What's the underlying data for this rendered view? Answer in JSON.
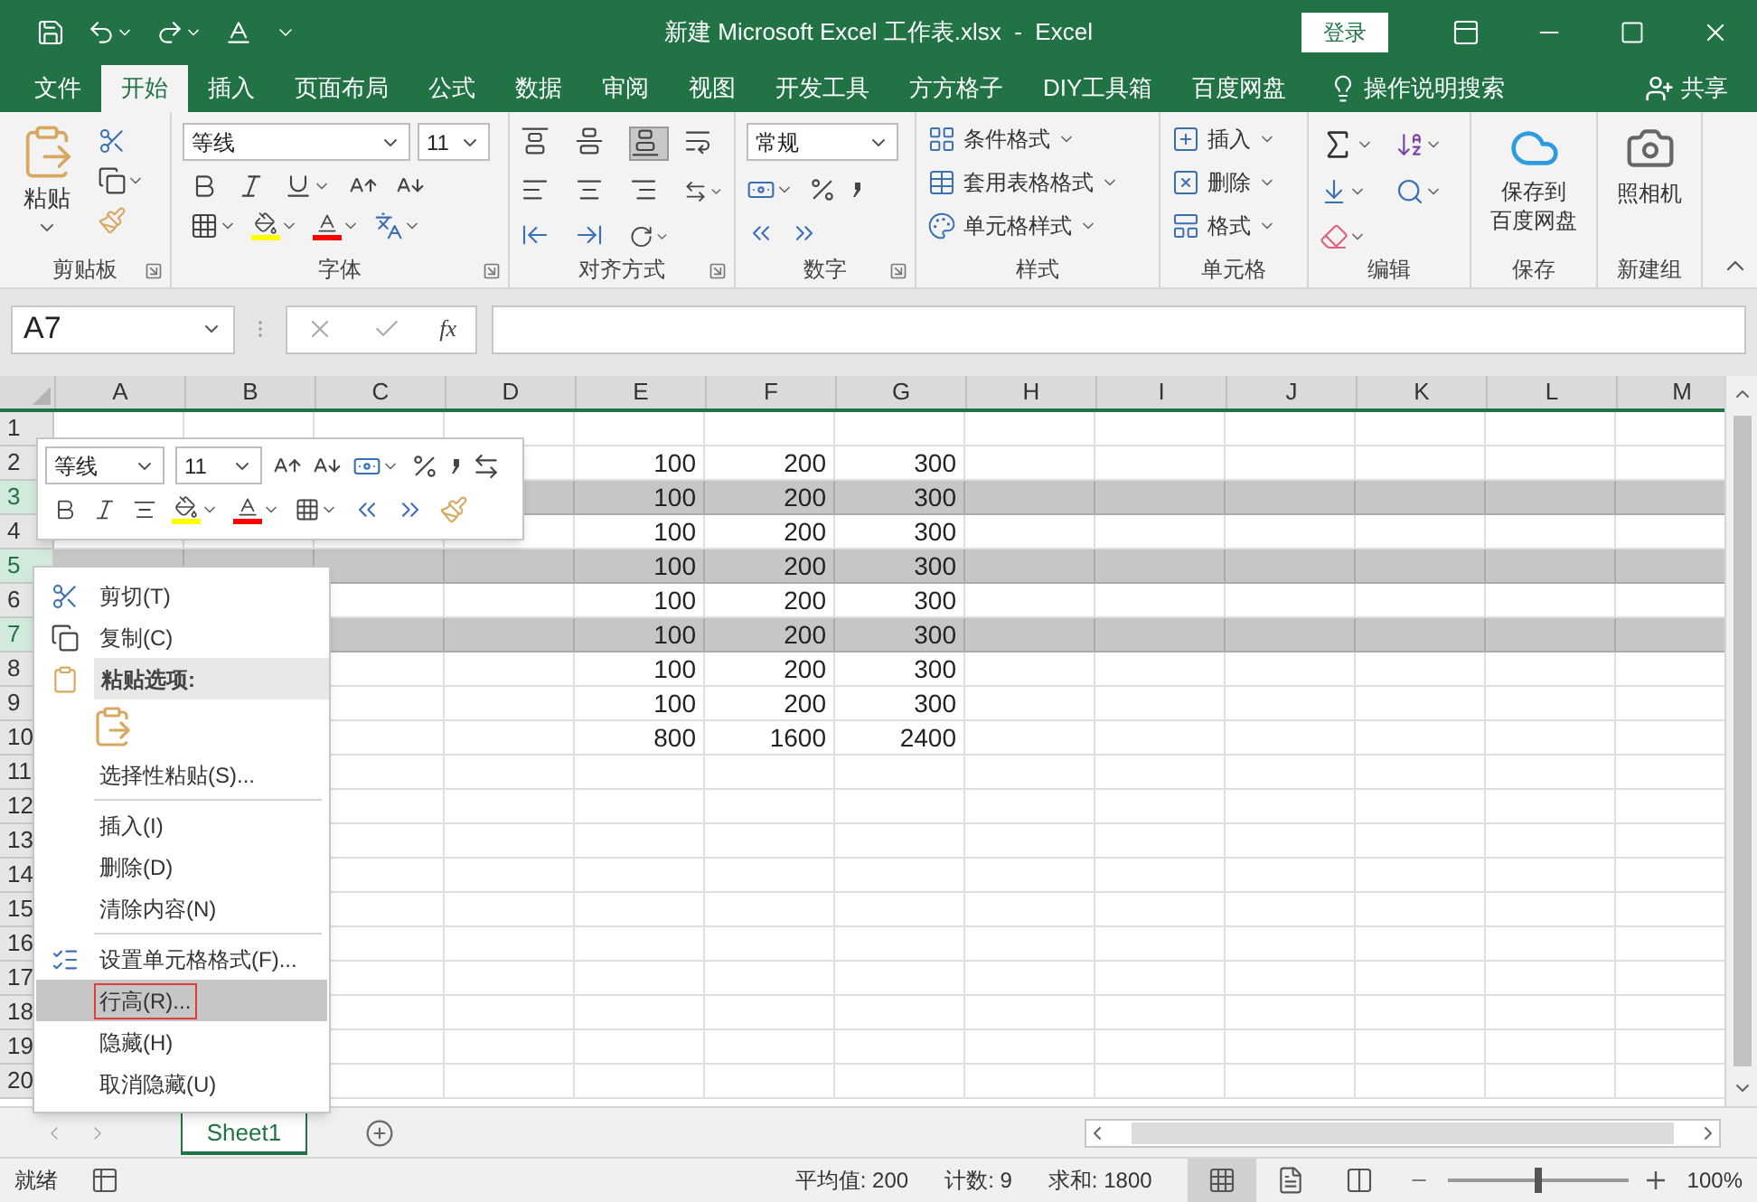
{
  "window": {
    "title": "新建 Microsoft Excel 工作表.xlsx  -  Excel",
    "login_button": "登录"
  },
  "tabs": [
    {
      "label": "文件",
      "selected": false
    },
    {
      "label": "开始",
      "selected": true
    },
    {
      "label": "插入",
      "selected": false
    },
    {
      "label": "页面布局",
      "selected": false
    },
    {
      "label": "公式",
      "selected": false
    },
    {
      "label": "数据",
      "selected": false
    },
    {
      "label": "审阅",
      "selected": false
    },
    {
      "label": "视图",
      "selected": false
    },
    {
      "label": "开发工具",
      "selected": false
    },
    {
      "label": "方方格子",
      "selected": false
    },
    {
      "label": "DIY工具箱",
      "selected": false
    },
    {
      "label": "百度网盘",
      "selected": false
    }
  ],
  "tell_me": "操作说明搜索",
  "share": "共享",
  "ribbon": {
    "clipboard": {
      "paste": "粘贴",
      "label": "剪贴板"
    },
    "font": {
      "font_name": "等线",
      "font_size": "11",
      "label": "字体"
    },
    "alignment": {
      "label": "对齐方式"
    },
    "number": {
      "format": "常规",
      "label": "数字"
    },
    "styles": {
      "items": [
        "条件格式",
        "套用表格格式",
        "单元格样式"
      ],
      "label": "样式"
    },
    "cells": {
      "items": [
        "插入",
        "删除",
        "格式"
      ],
      "label": "单元格"
    },
    "editing": {
      "label": "编辑"
    },
    "save": {
      "button": [
        "保存到",
        "百度网盘"
      ],
      "label": "保存"
    },
    "new_group": {
      "button": "照相机",
      "label": "新建组"
    }
  },
  "formula_bar": {
    "name_box": "A7",
    "function_label": "fx"
  },
  "sheet": {
    "columns": [
      "A",
      "B",
      "C",
      "D",
      "E",
      "F",
      "G",
      "H",
      "I",
      "J",
      "K",
      "L",
      "M"
    ],
    "rows": [
      {
        "number": "1",
        "selected": false
      },
      {
        "number": "2",
        "selected": false,
        "cells": {
          "E": "100",
          "F": "200",
          "G": "300"
        }
      },
      {
        "number": "3",
        "selected": true,
        "cells": {
          "E": "100",
          "F": "200",
          "G": "300"
        }
      },
      {
        "number": "4",
        "selected": false,
        "cells": {
          "E": "100",
          "F": "200",
          "G": "300"
        }
      },
      {
        "number": "5",
        "selected": true,
        "cells": {
          "E": "100",
          "F": "200",
          "G": "300"
        }
      },
      {
        "number": "6",
        "selected": false,
        "cells": {
          "E": "100",
          "F": "200",
          "G": "300"
        }
      },
      {
        "number": "7",
        "selected": true,
        "cells": {
          "E": "100",
          "F": "200",
          "G": "300"
        }
      },
      {
        "number": "8",
        "selected": false,
        "cells": {
          "E": "100",
          "F": "200",
          "G": "300"
        }
      },
      {
        "number": "9",
        "selected": false,
        "cells": {
          "E": "100",
          "F": "200",
          "G": "300"
        }
      },
      {
        "number": "10",
        "selected": false,
        "cells": {
          "E": "800",
          "F": "1600",
          "G": "2400"
        }
      },
      {
        "number": "11",
        "selected": false
      },
      {
        "number": "12",
        "selected": false
      },
      {
        "number": "13",
        "selected": false
      },
      {
        "number": "14",
        "selected": false
      },
      {
        "number": "15",
        "selected": false
      },
      {
        "number": "16",
        "selected": false
      },
      {
        "number": "17",
        "selected": false
      },
      {
        "number": "18",
        "selected": false
      },
      {
        "number": "19",
        "selected": false
      },
      {
        "number": "20",
        "selected": false
      }
    ]
  },
  "mini_toolbar": {
    "font_name": "等线",
    "font_size": "11"
  },
  "context_menu": [
    {
      "kind": "cut",
      "label": "剪切(T)",
      "selected": false
    },
    {
      "kind": "copy",
      "label": "复制(C)",
      "selected": false
    },
    {
      "kind": "header",
      "label": "粘贴选项:"
    },
    {
      "kind": "paste_option"
    },
    {
      "kind": "item",
      "label": "选择性粘贴(S)...",
      "selected": false
    },
    {
      "kind": "separator"
    },
    {
      "kind": "item",
      "label": "插入(I)",
      "selected": false
    },
    {
      "kind": "item",
      "label": "删除(D)",
      "selected": false
    },
    {
      "kind": "item",
      "label": "清除内容(N)",
      "selected": false
    },
    {
      "kind": "separator"
    },
    {
      "kind": "format",
      "label": "设置单元格格式(F)...",
      "selected": false
    },
    {
      "kind": "item",
      "label": "行高(R)...",
      "selected": true
    },
    {
      "kind": "item",
      "label": "隐藏(H)",
      "selected": false
    },
    {
      "kind": "item",
      "label": "取消隐藏(U)",
      "selected": false
    }
  ],
  "sheet_tabs": [
    {
      "label": "Sheet1",
      "selected": true
    }
  ],
  "status_bar": {
    "ready": "就绪",
    "average": "平均值: 200",
    "count": "计数: 9",
    "sum": "求和: 1800",
    "zoom": {
      "level": 0.5,
      "reading": "100%"
    }
  }
}
